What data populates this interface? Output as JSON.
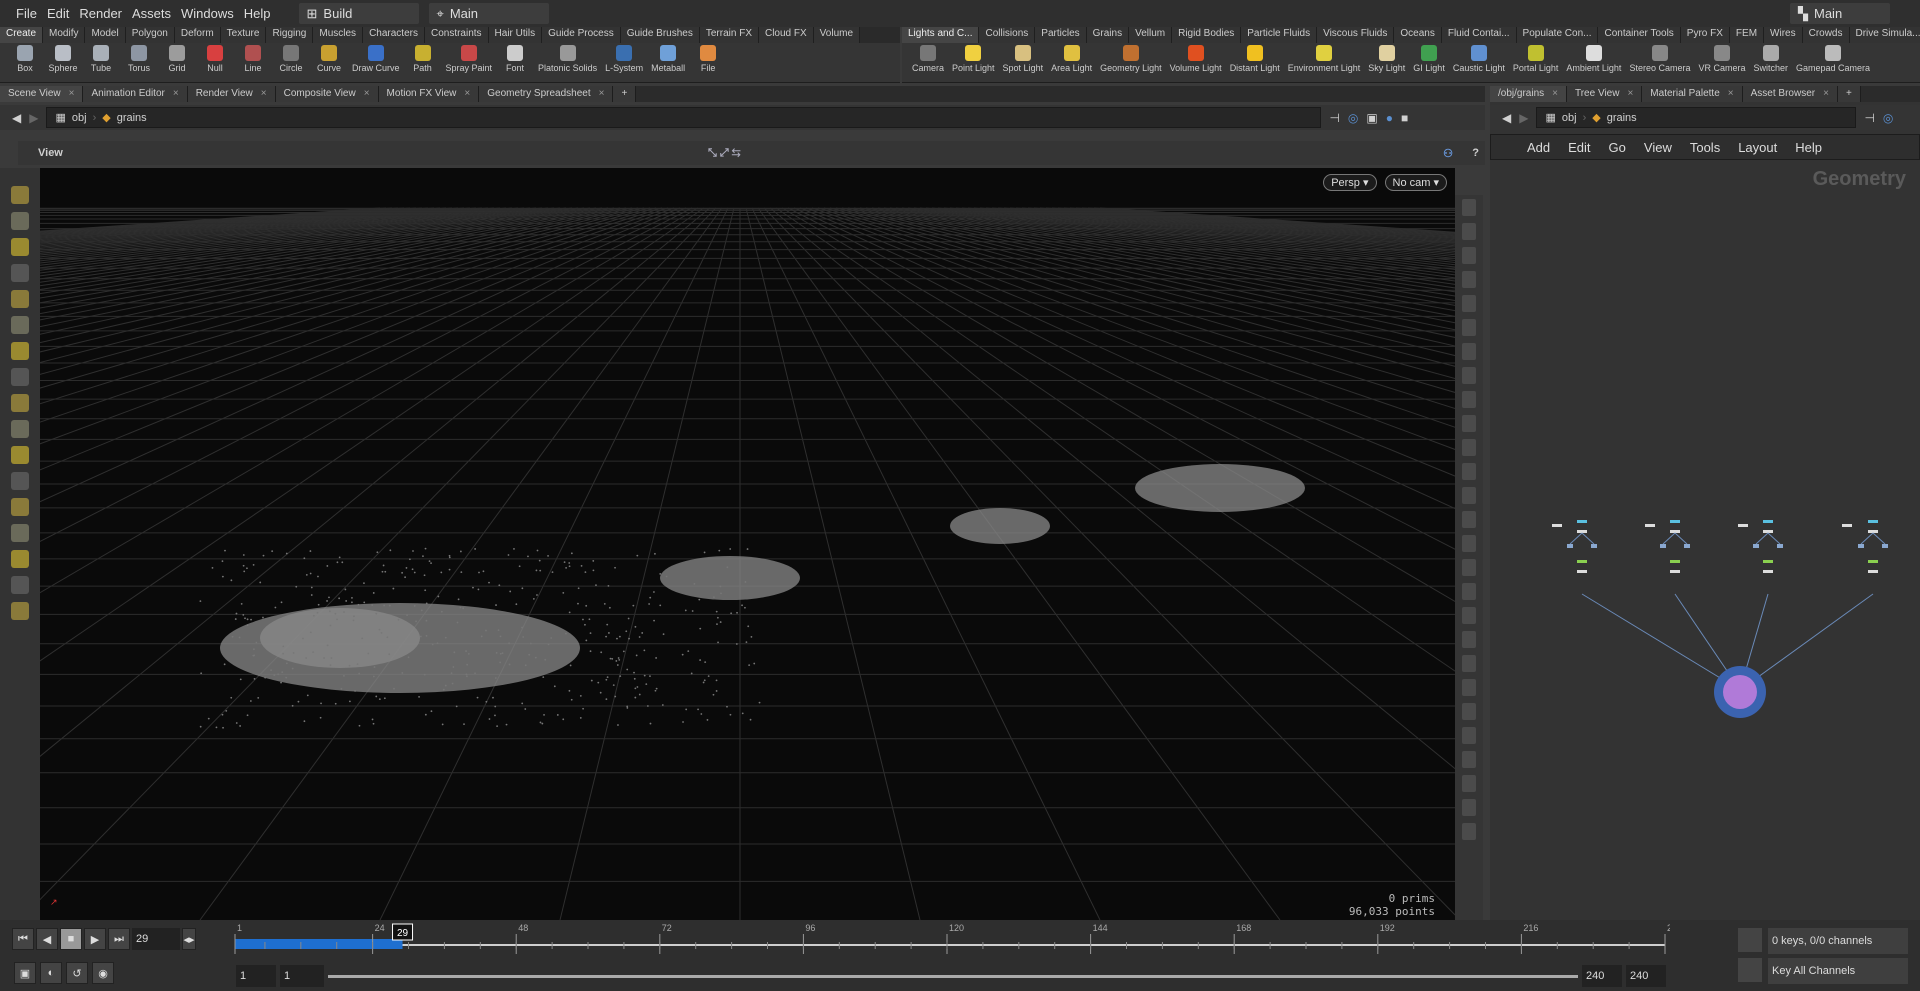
{
  "menubar": {
    "items": [
      "File",
      "Edit",
      "Render",
      "Assets",
      "Windows",
      "Help"
    ],
    "desktop": "Build",
    "context": "Main",
    "right_context": "Main"
  },
  "shelf_left": {
    "tabs": [
      "Create",
      "Modify",
      "Model",
      "Polygon",
      "Deform",
      "Texture",
      "Rigging",
      "Muscles",
      "Characters",
      "Constraints",
      "Hair Utils",
      "Guide Process",
      "Guide Brushes",
      "Terrain FX",
      "Cloud FX",
      "Volume"
    ],
    "tools": [
      {
        "label": "Box",
        "color": "#9aa4b0"
      },
      {
        "label": "Sphere",
        "color": "#b9bec6"
      },
      {
        "label": "Tube",
        "color": "#a9b0b8"
      },
      {
        "label": "Torus",
        "color": "#8d96a3"
      },
      {
        "label": "Grid",
        "color": "#9c9c9c"
      },
      {
        "label": "Null",
        "color": "#d84040"
      },
      {
        "label": "Line",
        "color": "#b05050"
      },
      {
        "label": "Circle",
        "color": "#777"
      },
      {
        "label": "Curve",
        "color": "#c8a030"
      },
      {
        "label": "Draw Curve",
        "color": "#3a70c8"
      },
      {
        "label": "Path",
        "color": "#c8b030"
      },
      {
        "label": "Spray Paint",
        "color": "#c84848"
      },
      {
        "label": "Font",
        "color": "#cccccc"
      },
      {
        "label": "Platonic Solids",
        "color": "#999"
      },
      {
        "label": "L-System",
        "color": "#3a6fb0"
      },
      {
        "label": "Metaball",
        "color": "#6fa0d8"
      },
      {
        "label": "File",
        "color": "#e08a40"
      }
    ]
  },
  "shelf_right": {
    "tabs": [
      "Lights and C...",
      "Collisions",
      "Particles",
      "Grains",
      "Vellum",
      "Rigid Bodies",
      "Particle Fluids",
      "Viscous Fluids",
      "Oceans",
      "Fluid Contai...",
      "Populate Con...",
      "Container Tools",
      "Pyro FX",
      "FEM",
      "Wires",
      "Crowds",
      "Drive Simula..."
    ],
    "tools": [
      {
        "label": "Camera",
        "color": "#777"
      },
      {
        "label": "Point Light",
        "color": "#f0d040"
      },
      {
        "label": "Spot Light",
        "color": "#d8c080"
      },
      {
        "label": "Area Light",
        "color": "#e0c040"
      },
      {
        "label": "Geometry Light",
        "color": "#c07030"
      },
      {
        "label": "Volume Light",
        "color": "#e05020"
      },
      {
        "label": "Distant Light",
        "color": "#f0c020"
      },
      {
        "label": "Environment Light",
        "color": "#e0d040"
      },
      {
        "label": "Sky Light",
        "color": "#e0d0a0"
      },
      {
        "label": "GI Light",
        "color": "#40a050"
      },
      {
        "label": "Caustic Light",
        "color": "#6090d0"
      },
      {
        "label": "Portal Light",
        "color": "#c0c030"
      },
      {
        "label": "Ambient Light",
        "color": "#dddddd"
      },
      {
        "label": "Stereo Camera",
        "color": "#888"
      },
      {
        "label": "VR Camera",
        "color": "#888"
      },
      {
        "label": "Switcher",
        "color": "#aaa"
      },
      {
        "label": "Gamepad Camera",
        "color": "#bbb"
      }
    ]
  },
  "left_panes": {
    "tabs": [
      "Scene View",
      "Animation Editor",
      "Render View",
      "Composite View",
      "Motion FX View",
      "Geometry Spreadsheet"
    ],
    "path": [
      "obj",
      "grains"
    ]
  },
  "viewer": {
    "title": "View",
    "persp": "Persp",
    "cam": "No cam",
    "prims_count": "0",
    "prims_label": "prims",
    "points_count": "96,033",
    "points_label": "points"
  },
  "right_panes": {
    "tabs": [
      "/obj/grains",
      "Tree View",
      "Material Palette",
      "Asset Browser"
    ],
    "path": [
      "obj",
      "grains"
    ],
    "menu": [
      "Add",
      "Edit",
      "Go",
      "View",
      "Tools",
      "Layout",
      "Help"
    ],
    "context_label": "Geometry"
  },
  "timeline": {
    "current_frame": "29",
    "start": 1,
    "end": 240,
    "ticks": [
      "1",
      "24",
      "48",
      "72",
      "96",
      "120",
      "144",
      "168",
      "192",
      "216",
      "2"
    ],
    "range_start": "1",
    "range_start2": "1",
    "range_end": "240",
    "range_end2": "240",
    "keys_status": "0 keys, 0/0 channels",
    "key_all": "Key All Channels"
  },
  "colors": {
    "timeline_fill": "#1e6fd0",
    "node_ring": "#3b63b0",
    "node_core": "#b07ad8"
  }
}
